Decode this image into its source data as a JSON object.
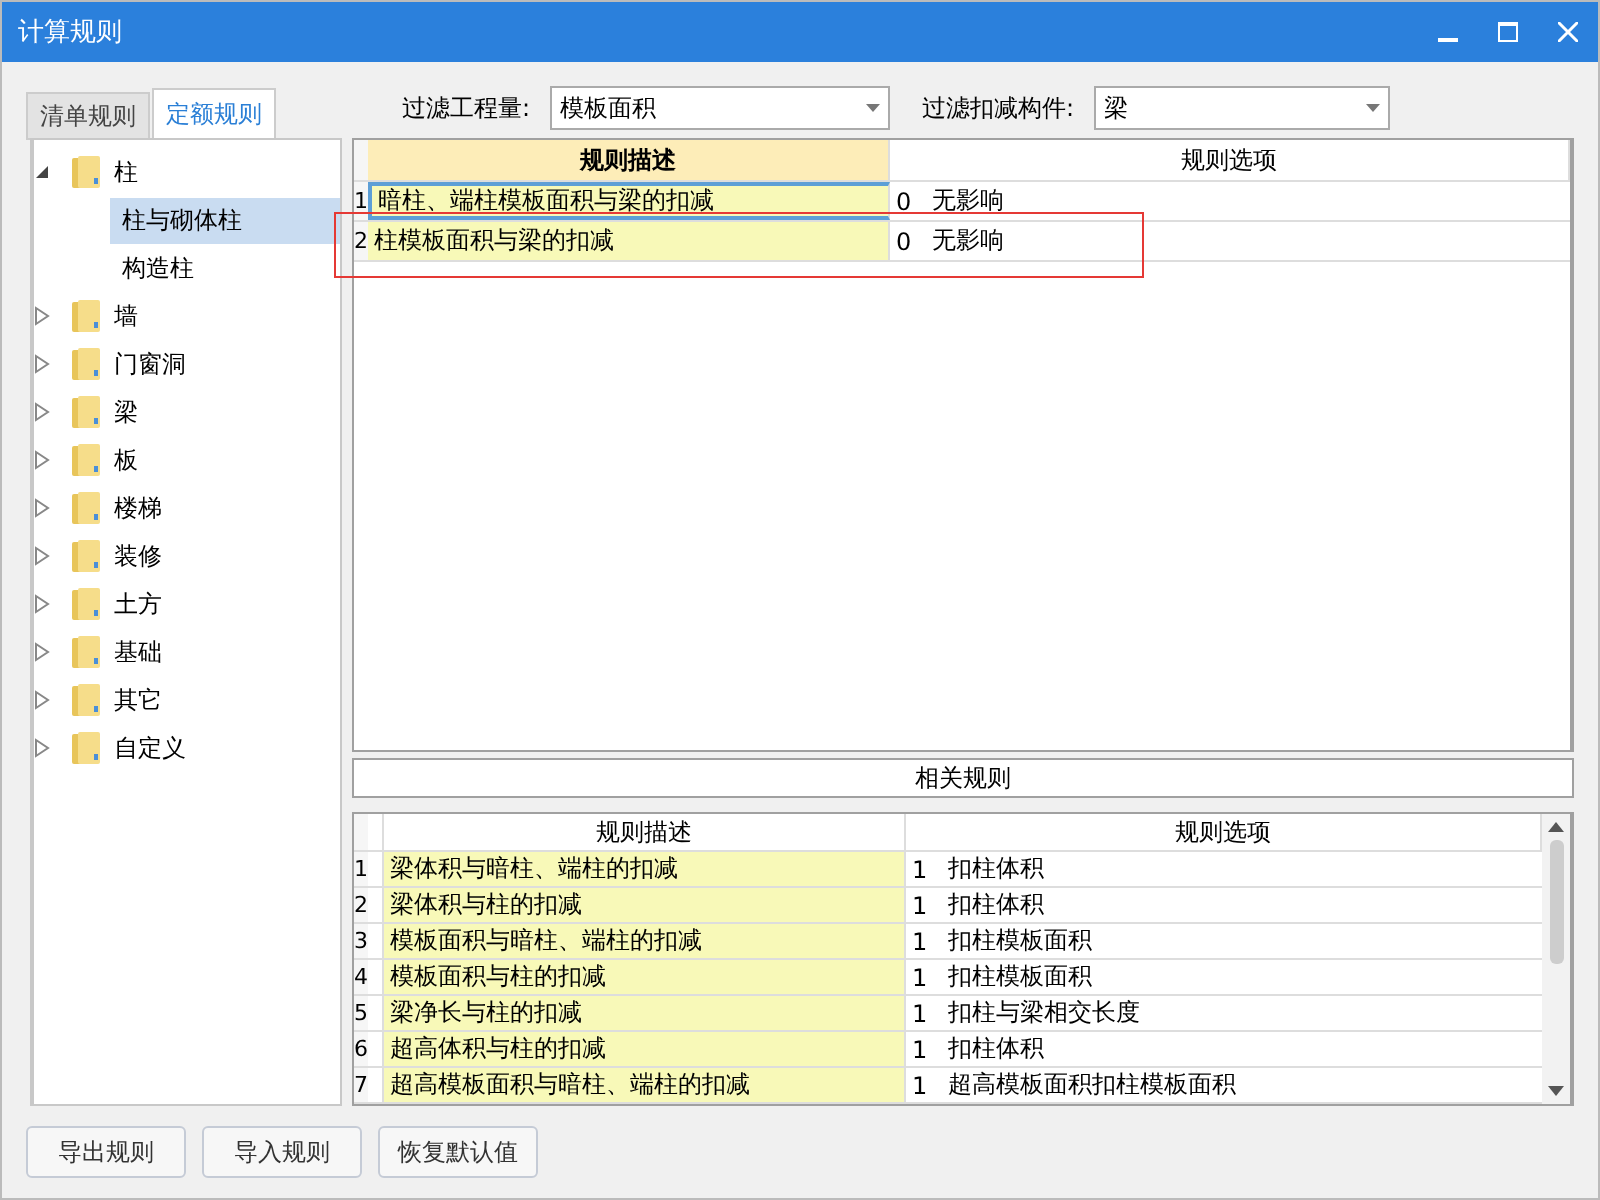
{
  "window": {
    "title": "计算规则"
  },
  "tabs": [
    {
      "label": "清单规则",
      "selected": false
    },
    {
      "label": "定额规则",
      "selected": true
    }
  ],
  "filters": [
    {
      "label": "过滤工程量:",
      "value": "模板面积"
    },
    {
      "label": "过滤扣减构件:",
      "value": "梁"
    }
  ],
  "tree": [
    {
      "label": "柱",
      "expanded": true,
      "children": [
        {
          "label": "柱与砌体柱",
          "selected": true
        },
        {
          "label": "构造柱",
          "selected": false
        }
      ]
    },
    {
      "label": "墙",
      "expanded": false
    },
    {
      "label": "门窗洞",
      "expanded": false
    },
    {
      "label": "梁",
      "expanded": false
    },
    {
      "label": "板",
      "expanded": false
    },
    {
      "label": "楼梯",
      "expanded": false
    },
    {
      "label": "装修",
      "expanded": false
    },
    {
      "label": "土方",
      "expanded": false
    },
    {
      "label": "基础",
      "expanded": false
    },
    {
      "label": "其它",
      "expanded": false
    },
    {
      "label": "自定义",
      "expanded": false
    }
  ],
  "rules_table": {
    "columns": [
      "规则描述",
      "规则选项"
    ],
    "rows": [
      {
        "index": "1",
        "description": "暗柱、端柱模板面积与梁的扣减",
        "code": "0",
        "option": "无影响",
        "selected": true,
        "highlighted": false
      },
      {
        "index": "2",
        "description": "柱模板面积与梁的扣减",
        "code": "0",
        "option": "无影响",
        "selected": false,
        "highlighted": true
      }
    ]
  },
  "related_rules": {
    "title": "相关规则",
    "columns": [
      "规则描述",
      "规则选项"
    ],
    "rows": [
      {
        "index": "1",
        "description": "梁体积与暗柱、端柱的扣减",
        "code": "1",
        "option": "扣柱体积"
      },
      {
        "index": "2",
        "description": "梁体积与柱的扣减",
        "code": "1",
        "option": "扣柱体积"
      },
      {
        "index": "3",
        "description": "模板面积与暗柱、端柱的扣减",
        "code": "1",
        "option": "扣柱模板面积"
      },
      {
        "index": "4",
        "description": "模板面积与柱的扣减",
        "code": "1",
        "option": "扣柱模板面积"
      },
      {
        "index": "5",
        "description": "梁净长与柱的扣减",
        "code": "1",
        "option": "扣柱与梁相交长度"
      },
      {
        "index": "6",
        "description": "超高体积与柱的扣减",
        "code": "1",
        "option": "扣柱体积"
      },
      {
        "index": "7",
        "description": "超高模板面积与暗柱、端柱的扣减",
        "code": "1",
        "option": "超高模板面积扣柱模板面积"
      }
    ]
  },
  "buttons": [
    "导出规则",
    "导入规则",
    "恢复默认值"
  ]
}
